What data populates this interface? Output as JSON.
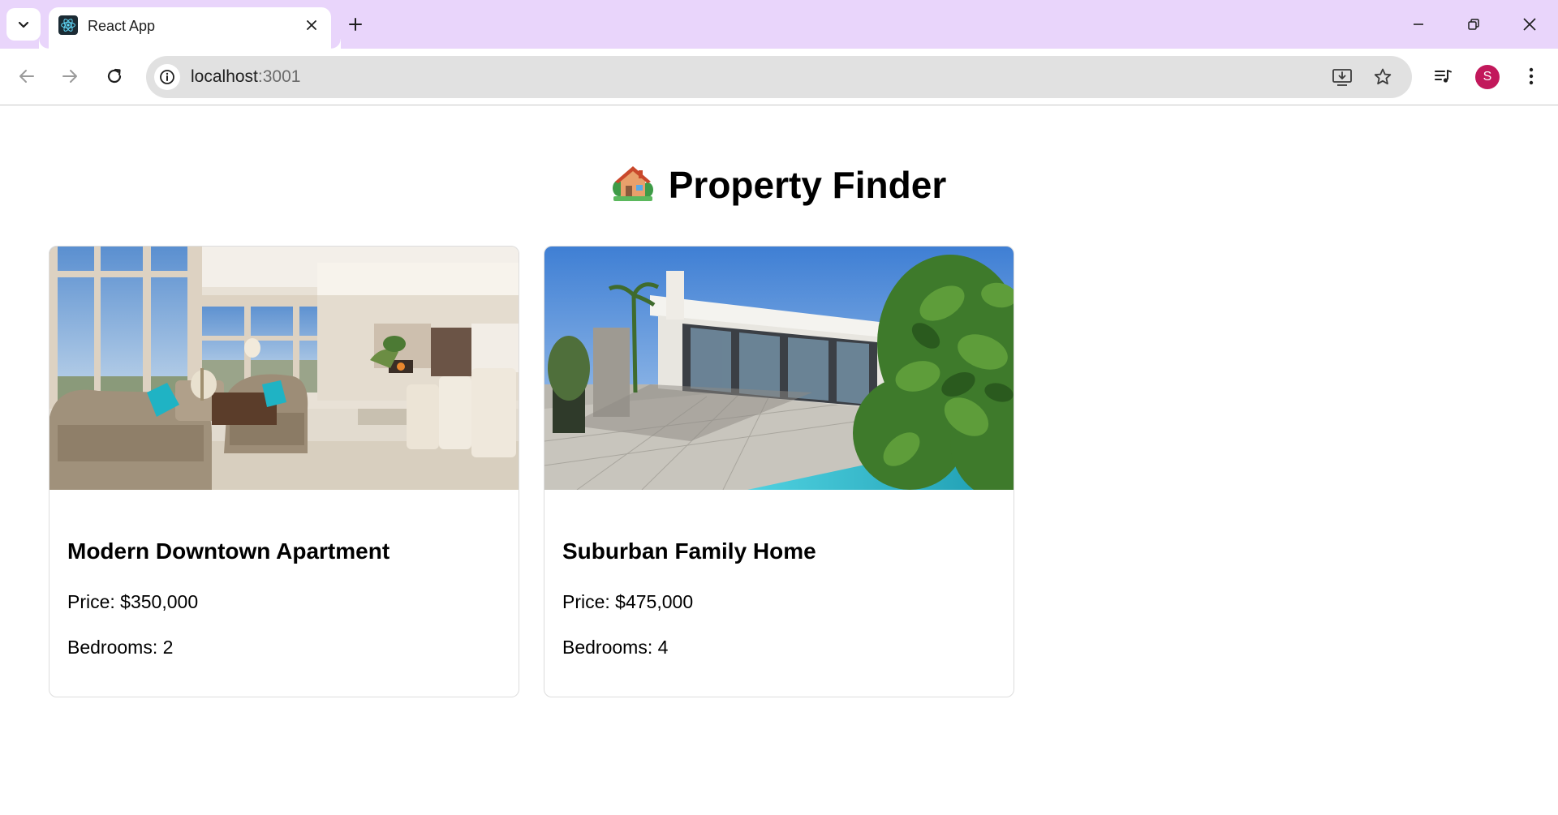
{
  "browser": {
    "tab_title": "React App",
    "url_host": "localhost",
    "url_port": ":3001",
    "profile_initial": "S",
    "profile_color": "#c2185b",
    "tabstrip_color": "#e9d5fb"
  },
  "page": {
    "title": "Property Finder",
    "title_icon": "house-with-garden-emoji"
  },
  "properties": [
    {
      "name": "Modern Downtown Apartment",
      "price": "Price: $350,000",
      "bedrooms": "Bedrooms: 2",
      "image": "living-room-interior-photo"
    },
    {
      "name": "Suburban Family Home",
      "price": "Price: $475,000",
      "bedrooms": "Bedrooms: 4",
      "image": "modern-house-pool-photo"
    }
  ]
}
